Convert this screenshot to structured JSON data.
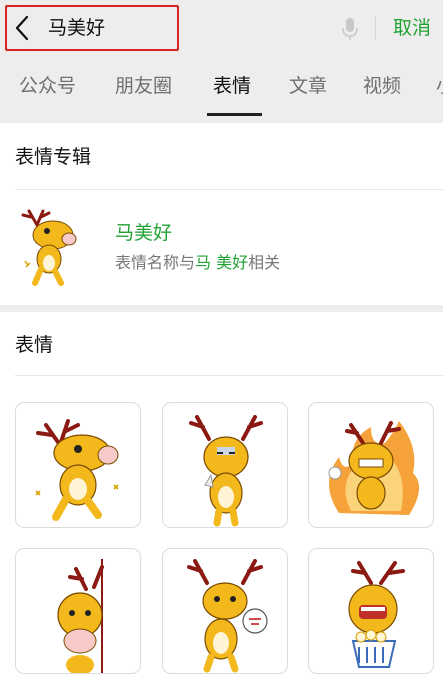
{
  "search": {
    "query": "马美好",
    "cancel_label": "取消"
  },
  "tabs": [
    {
      "label": "公众号"
    },
    {
      "label": "朋友圈"
    },
    {
      "label": "表情"
    },
    {
      "label": "文章"
    },
    {
      "label": "视频"
    },
    {
      "label": "小"
    }
  ],
  "active_tab": "表情",
  "album_section": {
    "title": "表情专辑",
    "item": {
      "name": "马美好",
      "desc_prefix": "表情名称与",
      "desc_hl": "马 美好",
      "desc_suffix": "相关"
    }
  },
  "sticker_section": {
    "title": "表情"
  },
  "stickers": [
    {
      "icon": "deer-sticker-peeking-icon"
    },
    {
      "icon": "deer-sticker-sneeze-icon"
    },
    {
      "icon": "deer-sticker-fire-icon"
    },
    {
      "icon": "deer-sticker-wall-peek-icon"
    },
    {
      "icon": "deer-sticker-speech-icon"
    },
    {
      "icon": "deer-sticker-popcorn-icon"
    }
  ],
  "colors": {
    "accent": "#23a234",
    "highlight_border": "#e02020",
    "deer_body": "#f2b81c",
    "antler": "#8b1a12"
  }
}
